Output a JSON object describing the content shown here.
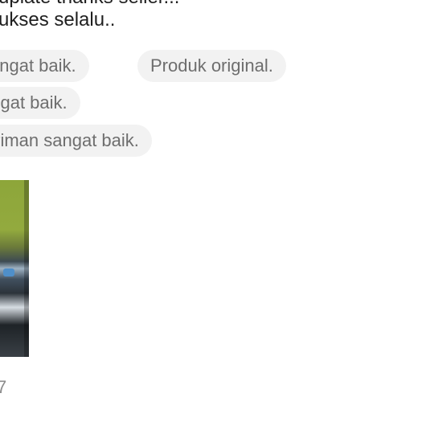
{
  "review": {
    "line_cut": "upiate thanks seller...",
    "line_main": "ukses selalu.."
  },
  "tags": [
    {
      "label": "sangat baik."
    },
    {
      "label": "Produk original."
    },
    {
      "label": "angat baik."
    },
    {
      "label": "giriman sangat baik."
    }
  ],
  "footer": {
    "meta": "7"
  }
}
